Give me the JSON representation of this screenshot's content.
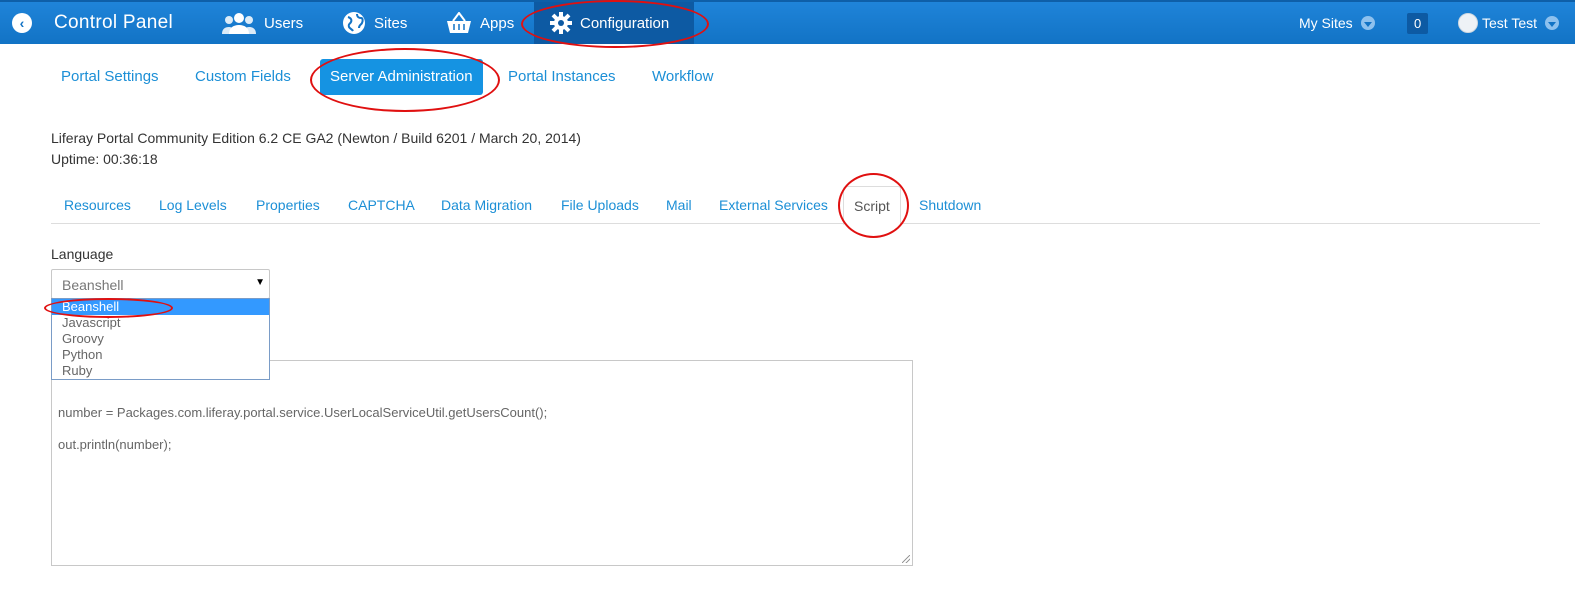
{
  "dock": {
    "title": "Control Panel",
    "items": [
      {
        "label": "Users",
        "icon": "users-icon"
      },
      {
        "label": "Sites",
        "icon": "globe-icon"
      },
      {
        "label": "Apps",
        "icon": "basket-icon"
      },
      {
        "label": "Configuration",
        "icon": "gear-icon"
      }
    ],
    "my_sites": "My Sites",
    "notifications": "0",
    "user": "Test Test"
  },
  "nav": {
    "items": [
      "Portal Settings",
      "Custom Fields",
      "Server Administration",
      "Portal Instances",
      "Workflow"
    ],
    "active": "Server Administration"
  },
  "version": {
    "line1": "Liferay Portal Community Edition 6.2 CE GA2 (Newton / Build 6201 / March 20, 2014)",
    "line2": "Uptime: 00:36:18"
  },
  "tabs": {
    "items": [
      "Resources",
      "Log Levels",
      "Properties",
      "CAPTCHA",
      "Data Migration",
      "File Uploads",
      "Mail",
      "External Services",
      "Script",
      "Shutdown"
    ],
    "active": "Script"
  },
  "language": {
    "label": "Language",
    "selected": "Beanshell",
    "options": [
      "Beanshell",
      "Javascript",
      "Groovy",
      "Python",
      "Ruby"
    ]
  },
  "script": {
    "lines": [
      "",
      "",
      "number = Packages.com.liferay.portal.service.UserLocalServiceUtil.getUsersCount();",
      "",
      "out.println(number);"
    ]
  },
  "colors": {
    "dock": "#1273c5",
    "accent": "#1c8fd6",
    "annotation": "#e01010"
  }
}
